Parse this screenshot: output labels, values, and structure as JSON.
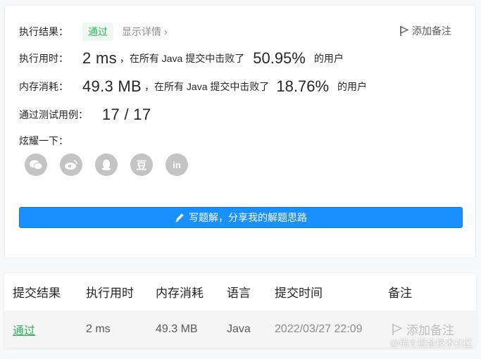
{
  "result": {
    "label": "执行结果：",
    "status": "通过",
    "details_link": "显示详情",
    "note_button": "添加备注"
  },
  "runtime": {
    "label": "执行用时：",
    "value": "2 ms",
    "prefix": "，在所有 Java 提交中击败了",
    "percent": "50.95%",
    "suffix": "的用户"
  },
  "memory": {
    "label": "内存消耗：",
    "value": "49.3 MB",
    "prefix": "，在所有 Java 提交中击败了",
    "percent": "18.76%",
    "suffix": "的用户"
  },
  "tests": {
    "label": "通过测试用例：",
    "value": "17 / 17"
  },
  "share": {
    "label": "炫耀一下：",
    "icons": [
      "wechat-icon",
      "weibo-icon",
      "qq-icon",
      "douban-icon",
      "linkedin-icon"
    ],
    "douban_glyph": "豆",
    "linkedin_glyph": "in"
  },
  "write_solution_button": "写题解，分享我的解题思路",
  "table": {
    "headers": [
      "提交结果",
      "执行用时",
      "内存消耗",
      "语言",
      "提交时间",
      "备注"
    ],
    "row": {
      "result": "通过",
      "runtime": "2 ms",
      "memory": "49.3 MB",
      "language": "Java",
      "time": "2022/03/27 22:09",
      "note": "添加备注"
    }
  },
  "watermark": "@稀土掘金技术社区",
  "colors": {
    "pass_green": "#2db55d",
    "primary_blue": "#1890ff",
    "icon_gray": "#c4c4c4"
  }
}
